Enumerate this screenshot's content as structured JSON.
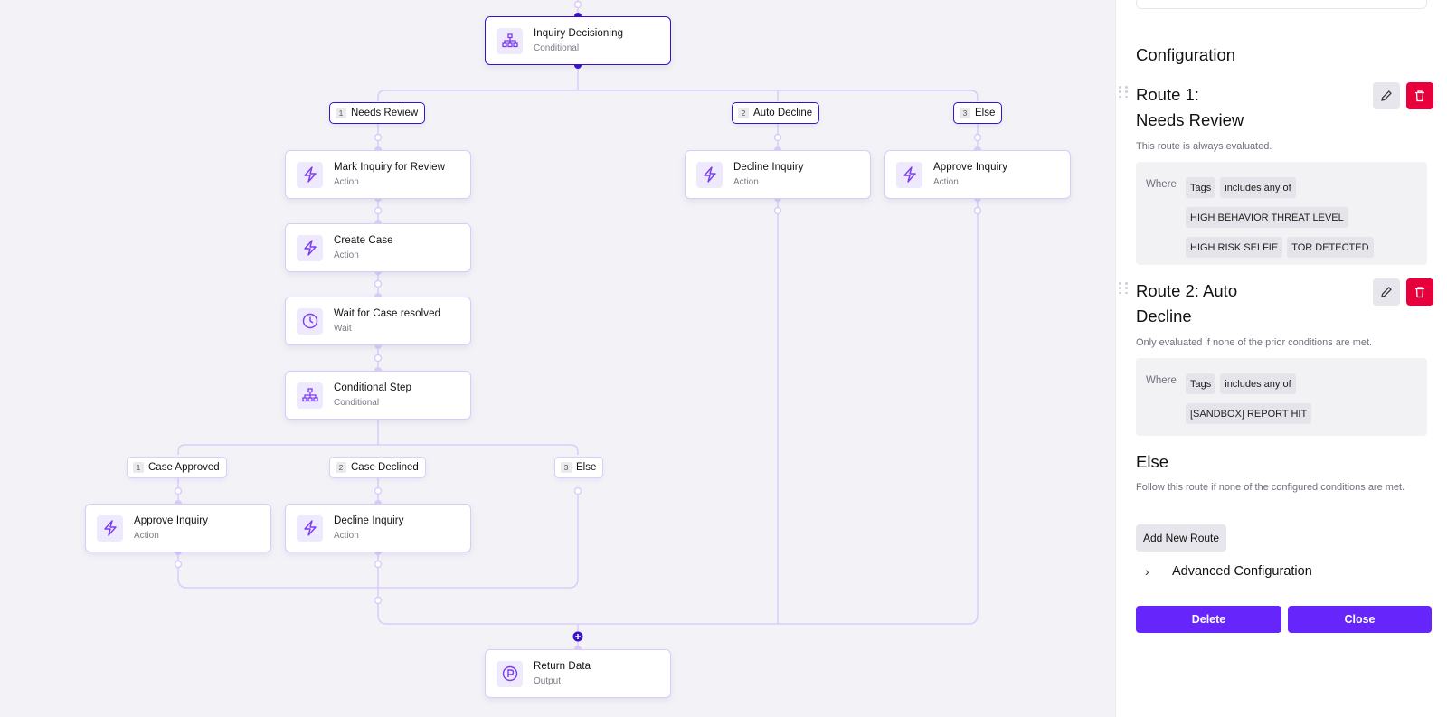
{
  "colors": {
    "accent": "#6525fb",
    "selected_border": "#3b0fd1",
    "edge": "#d9ccfb",
    "danger": "#e8003d",
    "canvas_bg": "#f3f3f7",
    "icon_bg": "#efe9fe",
    "icon_stroke": "#7a3cf0"
  },
  "canvas": {
    "nodes": [
      {
        "id": "inquiry-decisioning",
        "title": "Inquiry Decisioning",
        "type": "Conditional",
        "icon": "hierarchy-icon",
        "selected": true
      },
      {
        "id": "mark-inquiry-review",
        "title": "Mark Inquiry for Review",
        "type": "Action",
        "icon": "lightning-icon"
      },
      {
        "id": "create-case",
        "title": "Create Case",
        "type": "Action",
        "icon": "lightning-icon"
      },
      {
        "id": "wait-case-resolved",
        "title": "Wait for Case resolved",
        "type": "Wait",
        "icon": "clock-icon"
      },
      {
        "id": "conditional-step",
        "title": "Conditional Step",
        "type": "Conditional",
        "icon": "hierarchy-icon"
      },
      {
        "id": "approve-inquiry-1",
        "title": "Approve Inquiry",
        "type": "Action",
        "icon": "lightning-icon"
      },
      {
        "id": "decline-inquiry-1",
        "title": "Decline Inquiry",
        "type": "Action",
        "icon": "lightning-icon"
      },
      {
        "id": "decline-inquiry-2",
        "title": "Decline Inquiry",
        "type": "Action",
        "icon": "lightning-icon"
      },
      {
        "id": "approve-inquiry-2",
        "title": "Approve Inquiry",
        "type": "Action",
        "icon": "lightning-icon"
      },
      {
        "id": "return-data",
        "title": "Return Data",
        "type": "Output",
        "icon": "output-p-icon"
      }
    ],
    "branches": [
      {
        "num": "1",
        "label": "Needs Review",
        "selected": true
      },
      {
        "num": "2",
        "label": "Auto Decline",
        "selected": true
      },
      {
        "num": "3",
        "label": "Else",
        "selected": true
      },
      {
        "num": "1",
        "label": "Case Approved"
      },
      {
        "num": "2",
        "label": "Case Declined"
      },
      {
        "num": "3",
        "label": "Else"
      }
    ]
  },
  "panel": {
    "section_title": "Configuration",
    "routes": [
      {
        "title_line1": "Route 1:",
        "title_line2": "Needs Review",
        "description": "This route is always evaluated.",
        "where_label": "Where",
        "field": "Tags",
        "operator": "includes any of",
        "values": [
          "HIGH BEHAVIOR THREAT LEVEL",
          "HIGH RISK SELFIE",
          "TOR DETECTED"
        ]
      },
      {
        "title_line1": "Route 2: Auto",
        "title_line2": "Decline",
        "description": "Only evaluated if none of the prior conditions are met.",
        "where_label": "Where",
        "field": "Tags",
        "operator": "includes any of",
        "values": [
          "[SANDBOX] REPORT HIT"
        ]
      }
    ],
    "else": {
      "title": "Else",
      "description": "Follow this route if none of the configured conditions are met."
    },
    "add_route_label": "Add New Route",
    "advanced_label": "Advanced Configuration",
    "delete_label": "Delete",
    "close_label": "Close"
  }
}
